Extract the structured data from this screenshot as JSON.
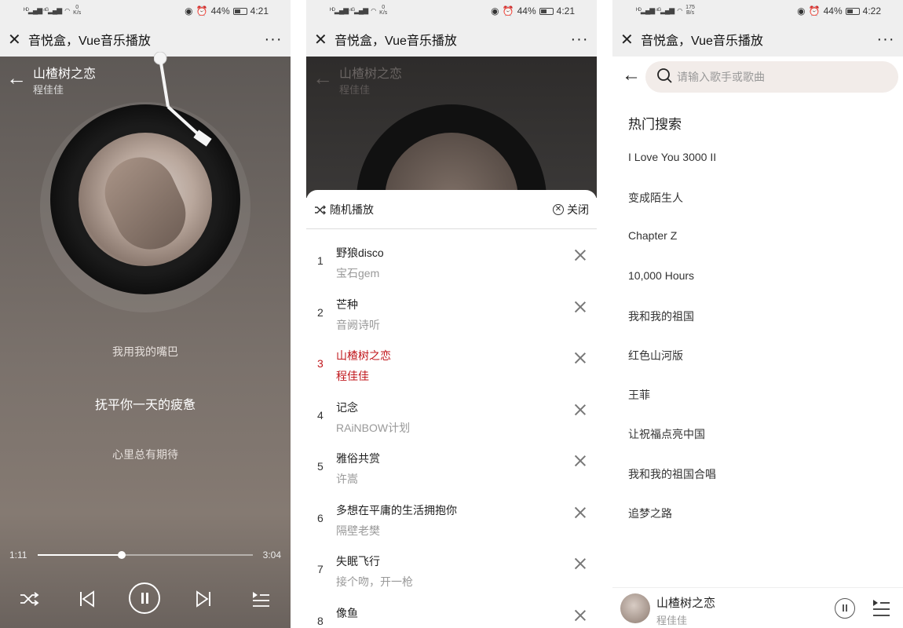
{
  "status_bar": [
    {
      "speed_value": "0",
      "speed_unit": "K/s",
      "battery": "44%",
      "time": "4:21"
    },
    {
      "speed_value": "0",
      "speed_unit": "K/s",
      "battery": "44%",
      "time": "4:21"
    },
    {
      "speed_value": "175",
      "speed_unit": "B/s",
      "battery": "44%",
      "time": "4:22"
    }
  ],
  "app_title": "音悦盒，Vue音乐播放",
  "player": {
    "song_title": "山楂树之恋",
    "singer": "程佳佳",
    "lyrics": [
      "我用我的嘴巴",
      "抚平你一天的疲惫",
      "心里总有期待"
    ],
    "current_time": "1:11",
    "total_time": "3:04",
    "progress": 0.39
  },
  "playlist": {
    "mode_label": "随机播放",
    "close_label": "关闭",
    "active_index": 2,
    "songs": [
      {
        "index": "1",
        "name": "野狼disco",
        "artist": "宝石gem"
      },
      {
        "index": "2",
        "name": "芒种",
        "artist": "音阙诗听"
      },
      {
        "index": "3",
        "name": "山楂树之恋",
        "artist": "程佳佳"
      },
      {
        "index": "4",
        "name": "记念",
        "artist": "RAiNBOW计划"
      },
      {
        "index": "5",
        "name": "雅俗共赏",
        "artist": "许嵩"
      },
      {
        "index": "6",
        "name": "多想在平庸的生活拥抱你",
        "artist": "隔壁老樊"
      },
      {
        "index": "7",
        "name": "失眠飞行",
        "artist": "接个吻，开一枪"
      },
      {
        "index": "8",
        "name": "像鱼",
        "artist": ""
      }
    ]
  },
  "search": {
    "placeholder": "请输入歌手或歌曲",
    "hot_title": "热门搜索",
    "hot_items": [
      "I Love You 3000 II",
      "变成陌生人",
      "Chapter Z",
      "10,000 Hours",
      "我和我的祖国",
      "红色山河版",
      "王菲",
      "让祝福点亮中国",
      "我和我的祖国合唱",
      "追梦之路"
    ]
  },
  "mini_player": {
    "song_title": "山楂树之恋",
    "singer": "程佳佳"
  },
  "colors": {
    "active_red": "#c0161b",
    "bar_gray": "#efefef"
  }
}
